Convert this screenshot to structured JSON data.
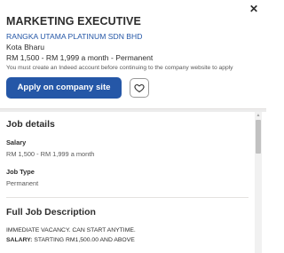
{
  "header": {
    "close_icon": "close-icon",
    "job_title": "MARKETING EXECUTIVE",
    "company": "RANGKA UTAMA PLATINUM SDN BHD",
    "location": "Kota Bharu",
    "salary_line": "RM 1,500 - RM 1,999 a month  - Permanent",
    "notice": "You must create an Indeed account before continuing to the company website to apply",
    "apply_label": "Apply on company site",
    "save_icon": "heart-icon",
    "accent_color": "#2557a7"
  },
  "job_details": {
    "heading": "Job details",
    "salary_label": "Salary",
    "salary_value": "RM 1,500 - RM 1,999 a month",
    "type_label": "Job Type",
    "type_value": "Permanent"
  },
  "description": {
    "heading": "Full Job Description",
    "line1": "IMMEDIATE VACANCY. CAN START ANYTIME.",
    "line2_label": "SALARY:",
    "line2_value": " STARTING RM1,500.00 AND ABOVE"
  }
}
